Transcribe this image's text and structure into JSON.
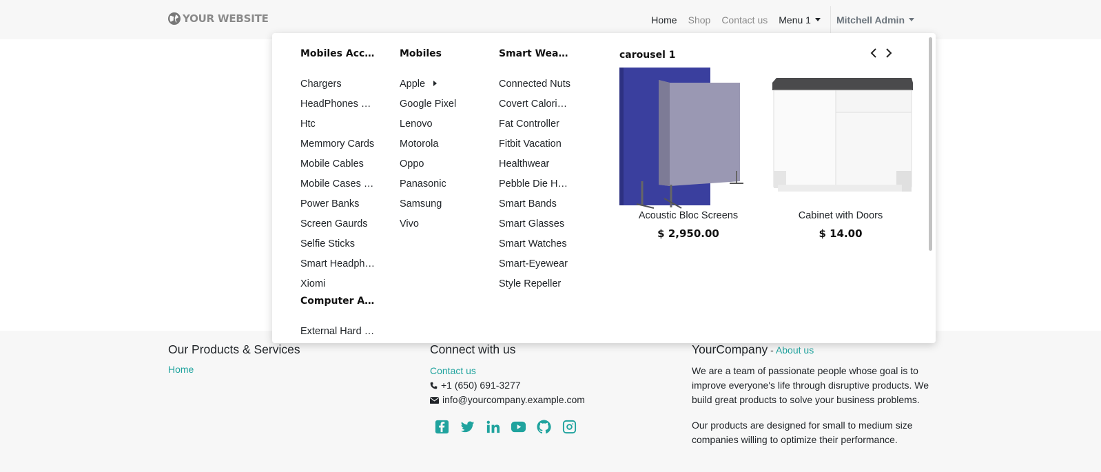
{
  "header": {
    "logo_text": "YOUR WEBSITE",
    "nav": {
      "home": "Home",
      "shop": "Shop",
      "contact": "Contact us",
      "menu1": "Menu 1",
      "user": "Mitchell Admin"
    }
  },
  "mega_menu": {
    "col1": {
      "title": "Mobiles Accessories",
      "items": [
        "Chargers",
        "HeadPhones & Earphones",
        "Htc",
        "Memmory Cards",
        "Mobile Cables",
        "Mobile Cases & Covers",
        "Power Banks",
        "Screen Gaurds",
        "Selfie Sticks",
        "Smart Headphones",
        "Xiomi"
      ],
      "title2": "Computer Accessories",
      "items2": [
        "External Hard Disks"
      ]
    },
    "col2": {
      "title": "Mobiles",
      "items": [
        "Apple",
        "Google Pixel",
        "Lenovo",
        "Motorola",
        "Oppo",
        "Panasonic",
        "Samsung",
        "Vivo"
      ]
    },
    "col3": {
      "title": "Smart Wearables",
      "items": [
        "Connected Nuts",
        "Covert Calorie Burners",
        "Fat Controller",
        "Fitbit Vacation",
        "Healthwear",
        "Pebble Die Hard",
        "Smart Bands",
        "Smart Glasses",
        "Smart Watches",
        "Smart-Eyewear",
        "Style Repeller"
      ]
    },
    "carousel": {
      "title": "carousel 1",
      "products": [
        {
          "name": "Acoustic Bloc Screens",
          "price": "$ 2,950.00"
        },
        {
          "name": "Cabinet with Doors",
          "price": "$ 14.00"
        }
      ]
    }
  },
  "footer": {
    "col1": {
      "title": "Our Products & Services",
      "link": "Home"
    },
    "col2": {
      "title": "Connect with us",
      "link": "Contact us",
      "phone": "+1 (650) 691-3277",
      "email": "info@yourcompany.example.com"
    },
    "col3": {
      "title": "YourCompany",
      "sep": " - ",
      "about": "About us",
      "p1": "We are a team of passionate people whose goal is to improve everyone's life through disruptive products. We build great products to solve your business problems.",
      "p2": "Our products are designed for small to medium size companies willing to optimize their performance."
    }
  },
  "colors": {
    "accent": "#20a39e",
    "header_bg": "#f7f7f7"
  }
}
